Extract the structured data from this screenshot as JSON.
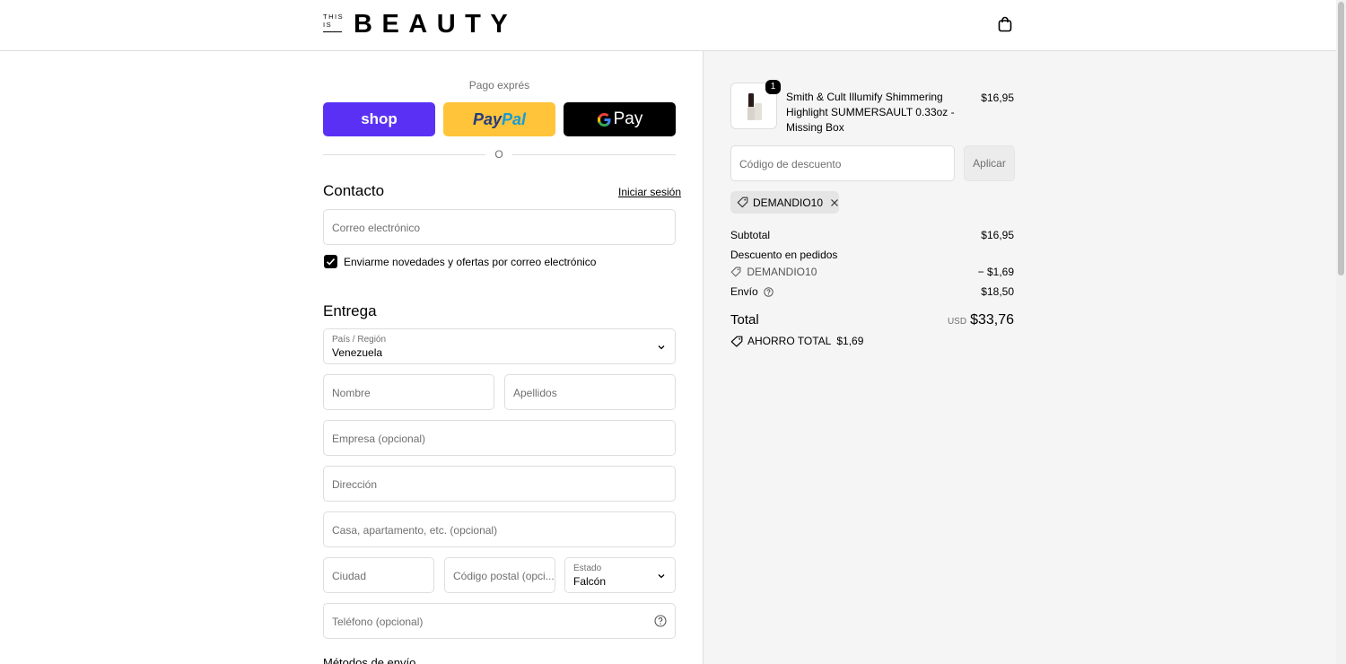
{
  "header": {
    "logo_small_top": "THIS",
    "logo_small_bottom": "IS",
    "logo_main": "BEAUTY",
    "cart_icon": "shopping-bag-icon"
  },
  "express": {
    "title": "Pago exprés",
    "shop_label": "shop",
    "paypal_a": "Pay",
    "paypal_b": "Pal",
    "gpay_label": "Pay",
    "separator": "O"
  },
  "contact": {
    "title": "Contacto",
    "login_link": "Iniciar sesión",
    "email_placeholder": "Correo electrónico",
    "newsletter_label": "Enviarme novedades y ofertas por correo electrónico",
    "newsletter_checked": true
  },
  "delivery": {
    "title": "Entrega",
    "country_label": "País / Región",
    "country_value": "Venezuela",
    "first_name": "Nombre",
    "last_name": "Apellidos",
    "company": "Empresa (opcional)",
    "address": "Dirección",
    "apartment": "Casa, apartamento, etc. (opcional)",
    "city": "Ciudad",
    "postal": "Código postal (opci...",
    "state_label": "Estado",
    "state_value": "Falcón",
    "phone": "Teléfono (opcional)",
    "shipping_methods_title": "Métodos de envío"
  },
  "summary": {
    "quantity": "1",
    "product_name": "Smith & Cult Illumify Shimmering Highlight SUMMERSAULT 0.33oz - Missing Box",
    "product_price": "$16,95",
    "discount_placeholder": "Código de descuento",
    "apply_label": "Aplicar",
    "applied_code": "DEMANDIO10",
    "subtotal_label": "Subtotal",
    "subtotal_value": "$16,95",
    "order_discount_label": "Descuento en pedidos",
    "discount_code": "DEMANDIO10",
    "discount_value": "− $1,69",
    "shipping_label": "Envío",
    "shipping_value": "$18,50",
    "total_label": "Total",
    "currency": "USD",
    "total_value": "$33,76",
    "savings_label": "AHORRO TOTAL",
    "savings_value": "$1,69"
  },
  "colors": {
    "shop": "#5a31f4",
    "paypal": "#ffc439",
    "gpay": "#000000",
    "summary_bg": "#f5f5f5"
  }
}
